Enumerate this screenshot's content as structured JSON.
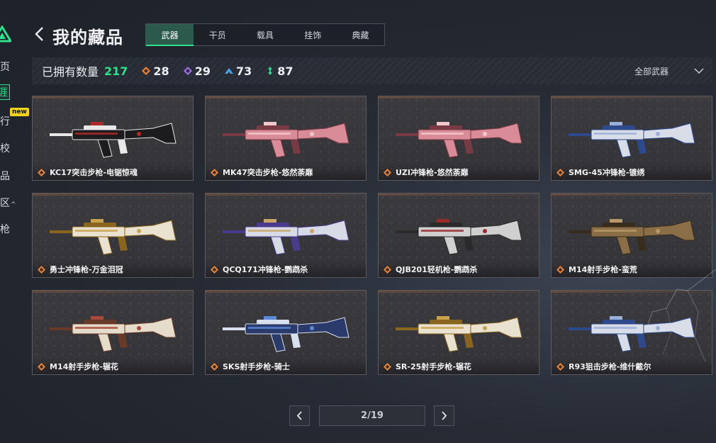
{
  "sidebar": {
    "items": [
      {
        "label": "页"
      },
      {
        "label": "涯"
      },
      {
        "label": "行"
      },
      {
        "label": "校"
      },
      {
        "label": "品"
      },
      {
        "label": "区"
      },
      {
        "label": "枪"
      }
    ],
    "new_badge": "new"
  },
  "header": {
    "title": "我的藏品",
    "tabs": [
      {
        "label": "武器",
        "active": true
      },
      {
        "label": "干员",
        "active": false
      },
      {
        "label": "载具",
        "active": false
      },
      {
        "label": "挂饰",
        "active": false
      },
      {
        "label": "典藏",
        "active": false
      }
    ]
  },
  "stats": {
    "owned_label": "已拥有数量",
    "owned_total": "217",
    "rarities": [
      {
        "icon": "orange-diamond-icon",
        "color": "#e8843c",
        "count": "28"
      },
      {
        "icon": "purple-diamond-icon",
        "color": "#a070e8",
        "count": "29"
      },
      {
        "icon": "blue-chevron-icon",
        "color": "#4aa3e8",
        "count": "73"
      },
      {
        "icon": "green-arrow-icon",
        "color": "#2fe08a",
        "count": "87"
      }
    ],
    "filter_label": "全部武器"
  },
  "items": [
    {
      "name": "KC17突击步枪-电锯惊魂",
      "palette": "black"
    },
    {
      "name": "MK47突击步枪-悠然荼靡",
      "palette": "pink"
    },
    {
      "name": "UZI冲锋枪-悠然荼靡",
      "palette": "pink"
    },
    {
      "name": "SMG-45冲锋枪-镀绣",
      "palette": "blue"
    },
    {
      "name": "勇士冲锋枪-万金泪冠",
      "palette": "gold"
    },
    {
      "name": "QCQ171冲锋枪-鹦鹉杀",
      "palette": "white"
    },
    {
      "name": "QJB201轻机枪-鹦鹉杀",
      "palette": "grey"
    },
    {
      "name": "M14射手步枪-蛮荒",
      "palette": "tan"
    },
    {
      "name": "M14射手步枪-辗花",
      "palette": "ivory"
    },
    {
      "name": "SKS射手步枪-骑士",
      "palette": "navy"
    },
    {
      "name": "SR-25射手步枪-辗花",
      "palette": "gold"
    },
    {
      "name": "R93狙击步枪-维什戴尔",
      "palette": "blue"
    }
  ],
  "pagination": {
    "current": "2/19"
  },
  "colors": {
    "accent": "#2fe08a",
    "rarity_orange": "#e8843c"
  }
}
